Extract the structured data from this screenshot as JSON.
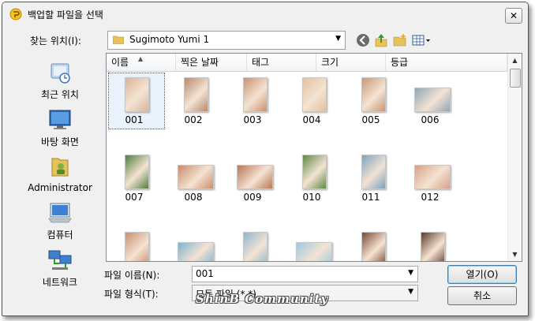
{
  "window": {
    "title": "백업할 파일을 선택",
    "close_glyph": "✕"
  },
  "toolbar": {
    "look_in_label": "찾는 위치(I):",
    "look_in_value": "Sugimoto Yumi 1",
    "icons": [
      "back-icon",
      "up-folder-icon",
      "new-folder-icon",
      "view-menu-icon"
    ]
  },
  "places": [
    {
      "label": "최근 위치",
      "icon": "recent-places-icon"
    },
    {
      "label": "바탕 화면",
      "icon": "desktop-icon"
    },
    {
      "label": "Administrator",
      "icon": "user-folder-icon"
    },
    {
      "label": "컴퓨터",
      "icon": "computer-icon"
    },
    {
      "label": "네트워크",
      "icon": "network-icon"
    }
  ],
  "columns": [
    "이름",
    "찍은 날짜",
    "태그",
    "크기",
    "등급"
  ],
  "files": [
    {
      "name": "001",
      "orientation": "portrait",
      "tone": "#d9b59b"
    },
    {
      "name": "002",
      "orientation": "portrait",
      "tone": "#b88a6e"
    },
    {
      "name": "003",
      "orientation": "portrait",
      "tone": "#c9906f"
    },
    {
      "name": "004",
      "orientation": "portrait",
      "tone": "#e3c0a1"
    },
    {
      "name": "005",
      "orientation": "portrait",
      "tone": "#c79876"
    },
    {
      "name": "006",
      "orientation": "landscape",
      "tone": "#8fa6b8"
    },
    {
      "name": "007",
      "orientation": "portrait",
      "tone": "#4f7f3e"
    },
    {
      "name": "008",
      "orientation": "landscape",
      "tone": "#c98d6a"
    },
    {
      "name": "009",
      "orientation": "landscape",
      "tone": "#b97755"
    },
    {
      "name": "010",
      "orientation": "portrait",
      "tone": "#5d8a46"
    },
    {
      "name": "011",
      "orientation": "portrait",
      "tone": "#7aa3c2"
    },
    {
      "name": "012",
      "orientation": "landscape",
      "tone": "#d7a189"
    },
    {
      "name": "",
      "orientation": "portrait",
      "tone": "#c98f6d"
    },
    {
      "name": "",
      "orientation": "landscape",
      "tone": "#7fb3d1"
    },
    {
      "name": "",
      "orientation": "portrait",
      "tone": "#8fb6cf"
    },
    {
      "name": "",
      "orientation": "landscape",
      "tone": "#9fcbe0"
    },
    {
      "name": "",
      "orientation": "portrait",
      "tone": "#7a4a32"
    },
    {
      "name": "",
      "orientation": "portrait",
      "tone": "#5c3b2a"
    }
  ],
  "selected_file": "001",
  "filename": {
    "label": "파일 이름(N):",
    "value": "001"
  },
  "filetype": {
    "label": "파일 형식(T):",
    "value": "모든 파일 (*.*)"
  },
  "buttons": {
    "open": "열기(O)",
    "cancel": "취소"
  },
  "watermark": "ShinB Community"
}
